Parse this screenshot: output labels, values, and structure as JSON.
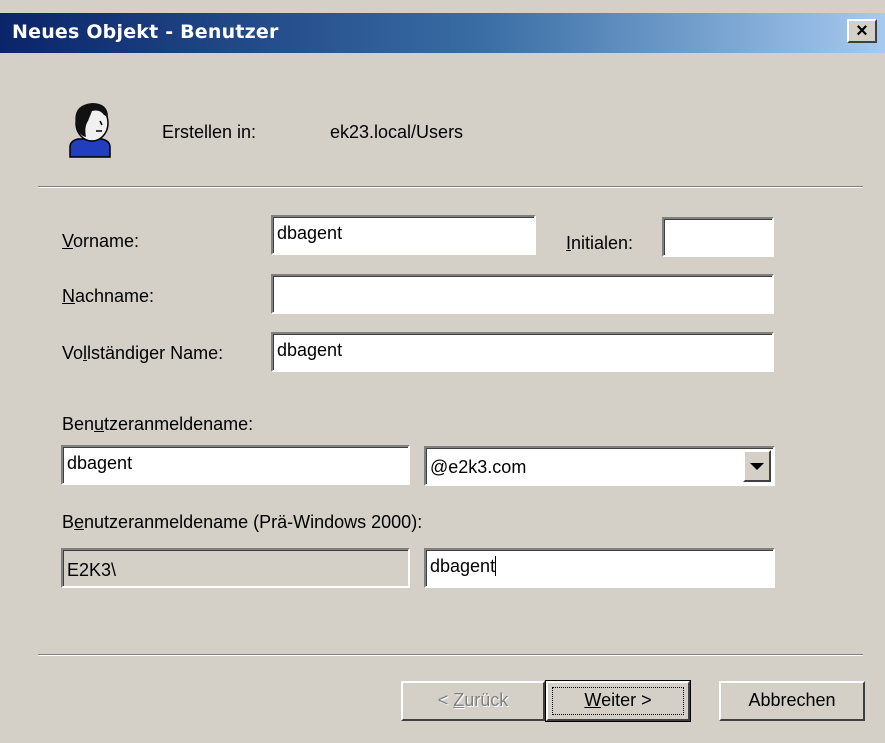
{
  "window": {
    "title": "Neues Objekt - Benutzer",
    "close_label": "×"
  },
  "header": {
    "create_in_label": "Erstellen in:",
    "create_in_value": "ek23.local/Users",
    "icon": "user-icon"
  },
  "form": {
    "first_name": {
      "label_pre": "",
      "label_acc": "V",
      "label_post": "orname:",
      "value": "dbagent"
    },
    "initials": {
      "label_pre": "",
      "label_acc": "I",
      "label_post": "nitialen:",
      "value": ""
    },
    "last_name": {
      "label_pre": "",
      "label_acc": "N",
      "label_post": "achname:",
      "value": ""
    },
    "full_name": {
      "label_pre": "Vo",
      "label_acc": "l",
      "label_post": "lständiger Name:",
      "value": "dbagent"
    },
    "logon_name": {
      "label_pre": "Ben",
      "label_acc": "u",
      "label_post": "tzeranmeldename:",
      "value": "dbagent",
      "domain": "@e2k3.com"
    },
    "pre2000": {
      "label_pre": "B",
      "label_acc": "e",
      "label_post": "nutzeranmeldename (Prä-Windows 2000):",
      "prefix": "E2K3\\",
      "value": "dbagent"
    }
  },
  "buttons": {
    "back": {
      "pre": "< ",
      "acc": "Z",
      "post": "urück"
    },
    "next": {
      "pre": "",
      "acc": "W",
      "post": "eiter >"
    },
    "cancel": "Abbrechen"
  },
  "colors": {
    "dialog_bg": "#d4d0c8",
    "title_start": "#0a246a",
    "title_end": "#a6caf0"
  }
}
